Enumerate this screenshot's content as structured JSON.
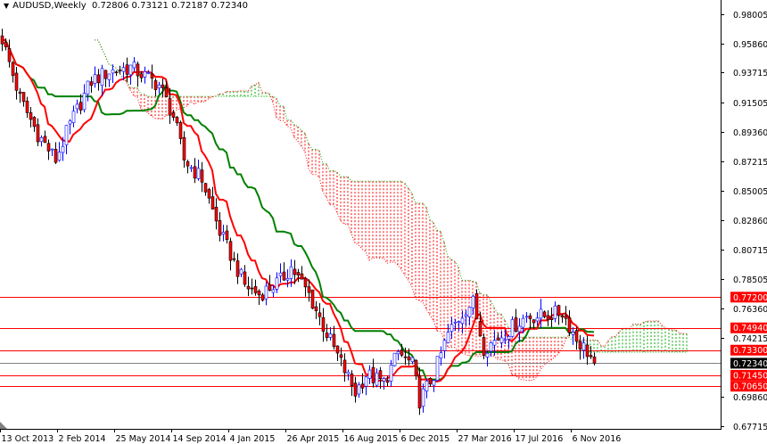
{
  "header": {
    "symbol_tf": "AUDUSD,Weekly",
    "ohlc": "0.72806 0.73121 0.72187 0.72340"
  },
  "colors": {
    "bull": "#0000ff",
    "bear": "#ff0000",
    "tenkan": "#ff0000",
    "kijun": "#008000",
    "cloud_bear": "#ff0000",
    "cloud_bull": "#00aa00",
    "level": "#ff0000",
    "current": "#808080"
  },
  "chart_data": {
    "type": "candlestick",
    "title": "AUDUSD,Weekly",
    "ylim": [
      0.67513,
      0.99054
    ],
    "grid": false,
    "indicator": "Ichimoku Kinko Hyo (9, 26, 52)",
    "last_bar": {
      "open": 0.72806,
      "high": 0.73121,
      "low": 0.72187,
      "close": 0.7234
    },
    "close_keypoints": [
      [
        0,
        0.962
      ],
      [
        5,
        0.918
      ],
      [
        10,
        0.892
      ],
      [
        15,
        0.873
      ],
      [
        19,
        0.899
      ],
      [
        25,
        0.931
      ],
      [
        30,
        0.938
      ],
      [
        36,
        0.941
      ],
      [
        44,
        0.928
      ],
      [
        48,
        0.905
      ],
      [
        51,
        0.873
      ],
      [
        56,
        0.859
      ],
      [
        61,
        0.82
      ],
      [
        68,
        0.781
      ],
      [
        72,
        0.774
      ],
      [
        78,
        0.784
      ],
      [
        81,
        0.794
      ],
      [
        86,
        0.774
      ],
      [
        91,
        0.745
      ],
      [
        99,
        0.702
      ],
      [
        102,
        0.715
      ],
      [
        107,
        0.709
      ],
      [
        111,
        0.731
      ],
      [
        115,
        0.722
      ],
      [
        117,
        0.696
      ],
      [
        121,
        0.715
      ],
      [
        125,
        0.745
      ],
      [
        130,
        0.764
      ],
      [
        132,
        0.768
      ],
      [
        135,
        0.735
      ],
      [
        137,
        0.738
      ],
      [
        142,
        0.748
      ],
      [
        147,
        0.758
      ],
      [
        152,
        0.758
      ],
      [
        157,
        0.761
      ],
      [
        161,
        0.741
      ],
      [
        164,
        0.732
      ],
      [
        166,
        0.7234
      ]
    ],
    "y_ticks": [
      "0.98005",
      "0.95860",
      "0.93715",
      "0.91505",
      "0.89360",
      "0.87215",
      "0.85005",
      "0.82860",
      "0.80715",
      "0.78505",
      "0.76360",
      "0.74215",
      "0.69860",
      "0.67715"
    ],
    "x_ticks": [
      {
        "bar": 0,
        "label": "13 Oct 2013"
      },
      {
        "bar": 16,
        "label": "2 Feb 2014"
      },
      {
        "bar": 32,
        "label": "25 May 2014"
      },
      {
        "bar": 48,
        "label": "14 Sep 2014"
      },
      {
        "bar": 64,
        "label": "4 Jan 2015"
      },
      {
        "bar": 80,
        "label": "26 Apr 2015"
      },
      {
        "bar": 96,
        "label": "16 Aug 2015"
      },
      {
        "bar": 112,
        "label": "6 Dec 2015"
      },
      {
        "bar": 128,
        "label": "27 Mar 2016"
      },
      {
        "bar": 144,
        "label": "17 Jul 2016"
      },
      {
        "bar": 160,
        "label": "6 Nov 2016"
      }
    ],
    "levels": [
      {
        "price": 0.772,
        "label": "0.77200",
        "kind": "resistance"
      },
      {
        "price": 0.7494,
        "label": "0.74940",
        "kind": "resistance"
      },
      {
        "price": 0.733,
        "label": "0.73300",
        "kind": "resistance"
      },
      {
        "price": 0.7234,
        "label": "0.72340",
        "kind": "current"
      },
      {
        "price": 0.7145,
        "label": "0.71450",
        "kind": "support"
      },
      {
        "price": 0.7065,
        "label": "0.70650",
        "kind": "support"
      }
    ]
  }
}
